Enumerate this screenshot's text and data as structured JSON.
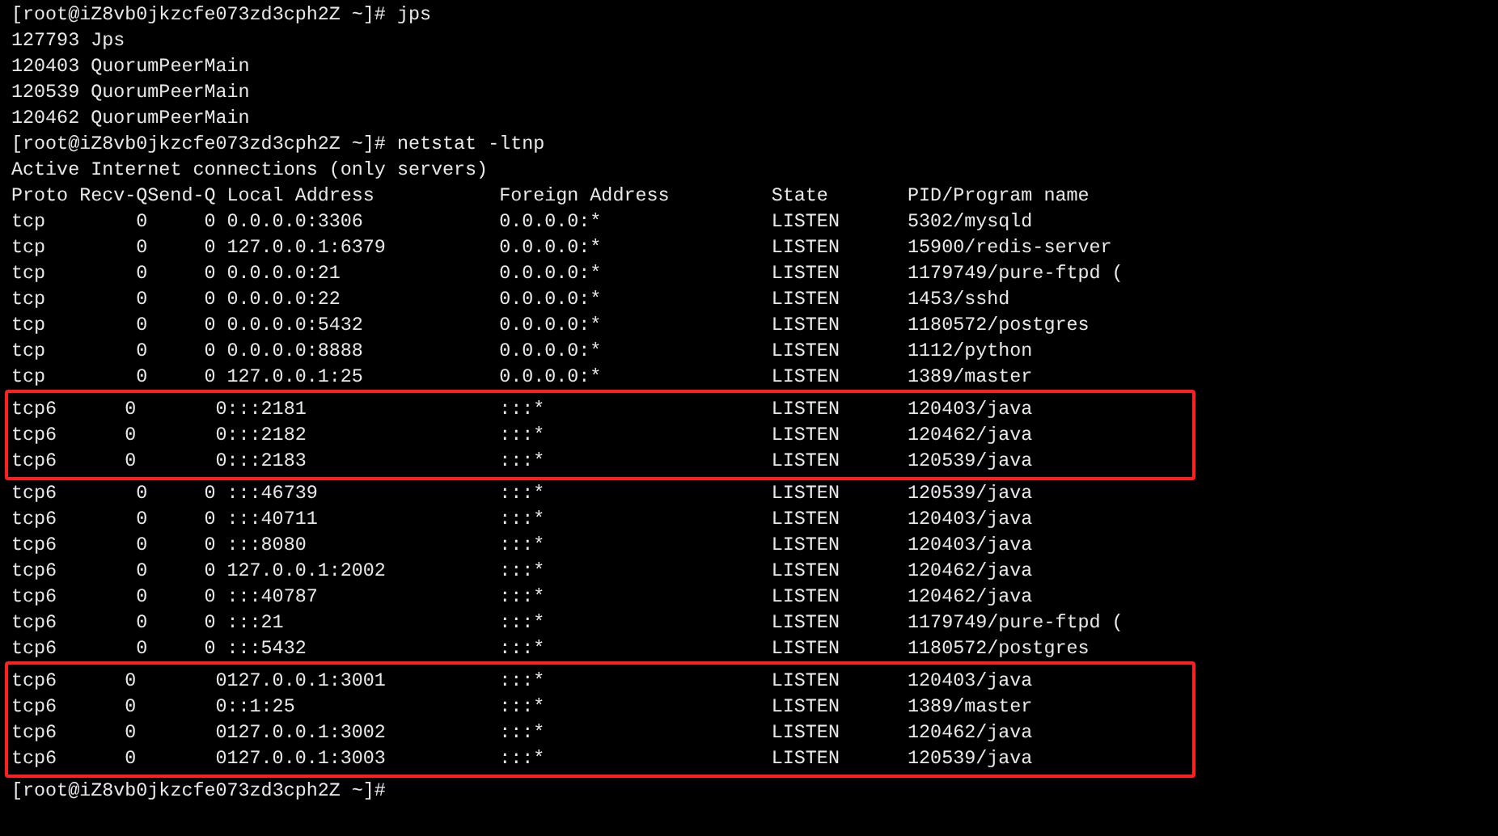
{
  "terminal": {
    "lines_before": [
      "[root@iZ8vb0jkzcfe073zd3cph2Z ~]# jps",
      "127793 Jps",
      "120403 QuorumPeerMain",
      "120539 QuorumPeerMain",
      "120462 QuorumPeerMain",
      "[root@iZ8vb0jkzcfe073zd3cph2Z ~]# netstat -ltnp",
      "Active Internet connections (only servers)"
    ],
    "table": {
      "columns": [
        "Proto",
        "Recv-Q",
        "Send-Q",
        "Local Address",
        "Foreign Address",
        "State",
        "PID/Program name"
      ],
      "row_groups": [
        {
          "highlighted": false,
          "rows": [
            [
              "tcp",
              "0",
              "0",
              "0.0.0.0:3306",
              "0.0.0.0:*",
              "LISTEN",
              "5302/mysqld"
            ],
            [
              "tcp",
              "0",
              "0",
              "127.0.0.1:6379",
              "0.0.0.0:*",
              "LISTEN",
              "15900/redis-server"
            ],
            [
              "tcp",
              "0",
              "0",
              "0.0.0.0:21",
              "0.0.0.0:*",
              "LISTEN",
              "1179749/pure-ftpd ("
            ],
            [
              "tcp",
              "0",
              "0",
              "0.0.0.0:22",
              "0.0.0.0:*",
              "LISTEN",
              "1453/sshd"
            ],
            [
              "tcp",
              "0",
              "0",
              "0.0.0.0:5432",
              "0.0.0.0:*",
              "LISTEN",
              "1180572/postgres"
            ],
            [
              "tcp",
              "0",
              "0",
              "0.0.0.0:8888",
              "0.0.0.0:*",
              "LISTEN",
              "1112/python"
            ],
            [
              "tcp",
              "0",
              "0",
              "127.0.0.1:25",
              "0.0.0.0:*",
              "LISTEN",
              "1389/master"
            ]
          ]
        },
        {
          "highlighted": true,
          "rows": [
            [
              "tcp6",
              "0",
              "0",
              ":::2181",
              ":::*",
              "LISTEN",
              "120403/java"
            ],
            [
              "tcp6",
              "0",
              "0",
              ":::2182",
              ":::*",
              "LISTEN",
              "120462/java"
            ],
            [
              "tcp6",
              "0",
              "0",
              ":::2183",
              ":::*",
              "LISTEN",
              "120539/java"
            ]
          ]
        },
        {
          "highlighted": false,
          "rows": [
            [
              "tcp6",
              "0",
              "0",
              ":::46739",
              ":::*",
              "LISTEN",
              "120539/java"
            ],
            [
              "tcp6",
              "0",
              "0",
              ":::40711",
              ":::*",
              "LISTEN",
              "120403/java"
            ],
            [
              "tcp6",
              "0",
              "0",
              ":::8080",
              ":::*",
              "LISTEN",
              "120403/java"
            ],
            [
              "tcp6",
              "0",
              "0",
              "127.0.0.1:2002",
              ":::*",
              "LISTEN",
              "120462/java"
            ],
            [
              "tcp6",
              "0",
              "0",
              ":::40787",
              ":::*",
              "LISTEN",
              "120462/java"
            ],
            [
              "tcp6",
              "0",
              "0",
              ":::21",
              ":::*",
              "LISTEN",
              "1179749/pure-ftpd ("
            ],
            [
              "tcp6",
              "0",
              "0",
              ":::5432",
              ":::*",
              "LISTEN",
              "1180572/postgres"
            ]
          ]
        },
        {
          "highlighted": true,
          "rows": [
            [
              "tcp6",
              "0",
              "0",
              "127.0.0.1:3001",
              ":::*",
              "LISTEN",
              "120403/java"
            ],
            [
              "tcp6",
              "0",
              "0",
              "::1:25",
              ":::*",
              "LISTEN",
              "1389/master"
            ],
            [
              "tcp6",
              "0",
              "0",
              "127.0.0.1:3002",
              ":::*",
              "LISTEN",
              "120462/java"
            ],
            [
              "tcp6",
              "0",
              "0",
              "127.0.0.1:3003",
              ":::*",
              "LISTEN",
              "120539/java"
            ]
          ]
        }
      ]
    },
    "lines_after": [
      "[root@iZ8vb0jkzcfe073zd3cph2Z ~]#"
    ]
  }
}
